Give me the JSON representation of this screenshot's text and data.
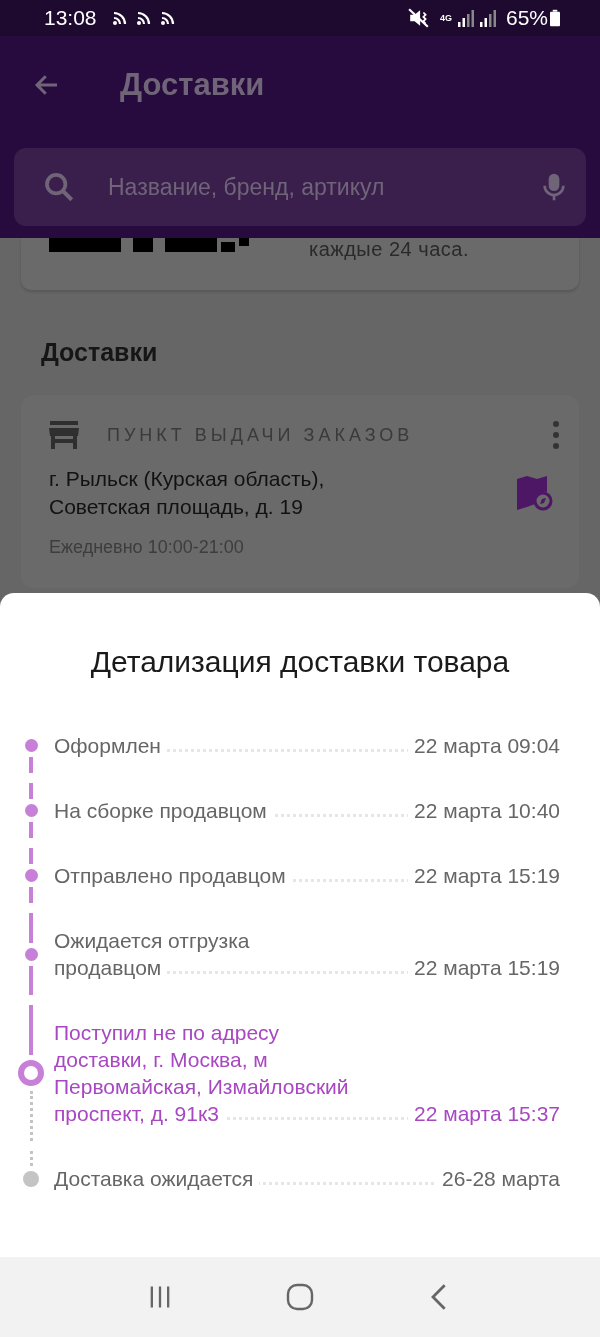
{
  "status_bar": {
    "time": "13:08",
    "network": "4G",
    "battery": "65%"
  },
  "app_bar": {
    "title": "Доставки"
  },
  "search": {
    "placeholder": "Название, бренд, артикул"
  },
  "qr_card": {
    "text": "каждые 24 часа."
  },
  "section_title": "Доставки",
  "pickup_card": {
    "type": "ПУНКТ ВЫДАЧИ ЗАКАЗОВ",
    "address": "г. Рыльск (Курская область), Советская площадь, д. 19",
    "hours": "Ежедневно 10:00-21:00"
  },
  "sheet": {
    "title": "Детализация доставки товара",
    "steps": [
      {
        "label": "Оформлен",
        "date": "22 марта 09:04",
        "kind": "done"
      },
      {
        "label": "На сборке продавцом",
        "date": "22 марта 10:40",
        "kind": "done"
      },
      {
        "label": "Отправлено продавцом",
        "date": "22 марта 15:19",
        "kind": "done"
      },
      {
        "label": "Ожидается отгрузка продавцом",
        "date": "22 марта 15:19",
        "kind": "done"
      },
      {
        "label": "Поступил не по адресу доставки, г. Москва, м Первомайская, Измайловский проспект, д. 91к3",
        "date": "22 марта 15:37",
        "kind": "current"
      },
      {
        "label": "Доставка ожидается",
        "date": "26-28 марта",
        "kind": "pending"
      }
    ]
  }
}
